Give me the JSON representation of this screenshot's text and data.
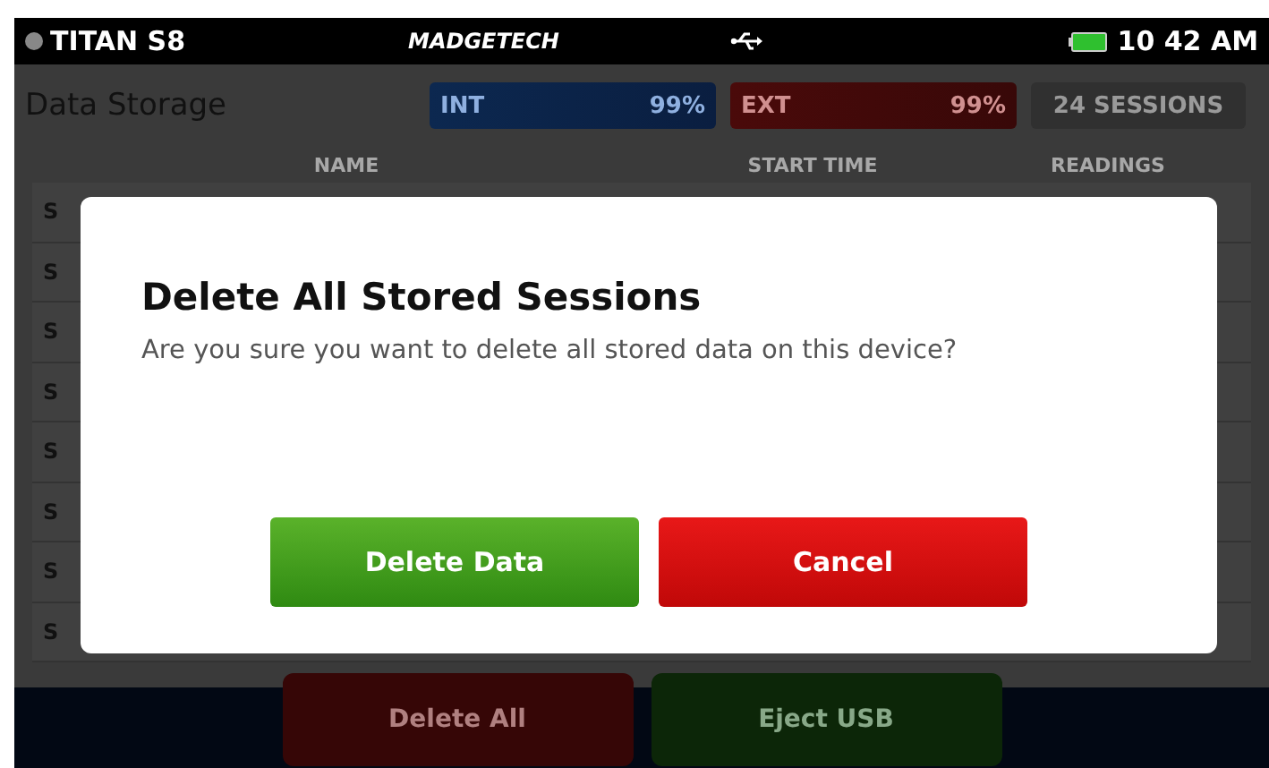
{
  "status_bar": {
    "device": "TITAN S8",
    "brand": "MADGETECH",
    "time": "10 42 AM"
  },
  "header": {
    "title": "Data Storage",
    "int": {
      "label": "INT",
      "reading": "99%"
    },
    "ext": {
      "label": "EXT",
      "reading": "99%"
    },
    "sessions": "24 SESSIONS"
  },
  "table": {
    "columns": [
      "NAME",
      "START TIME",
      "READINGS"
    ],
    "rows": [
      {
        "name": "S"
      },
      {
        "name": "S"
      },
      {
        "name": "S"
      },
      {
        "name": "S"
      },
      {
        "name": "S"
      },
      {
        "name": "S"
      },
      {
        "name": "S"
      },
      {
        "name": "S"
      }
    ]
  },
  "footer_buttons": [
    {
      "label": "Delete All",
      "kind": "danger"
    },
    {
      "label": "Eject USB",
      "kind": "ok"
    }
  ],
  "dialog": {
    "title": "Delete All Stored Sessions",
    "message": "Are you sure you want to delete all stored data on this device?",
    "buttons": [
      {
        "label": "Delete Data",
        "kind": "ok"
      },
      {
        "label": "Cancel",
        "kind": "danger"
      }
    ]
  }
}
